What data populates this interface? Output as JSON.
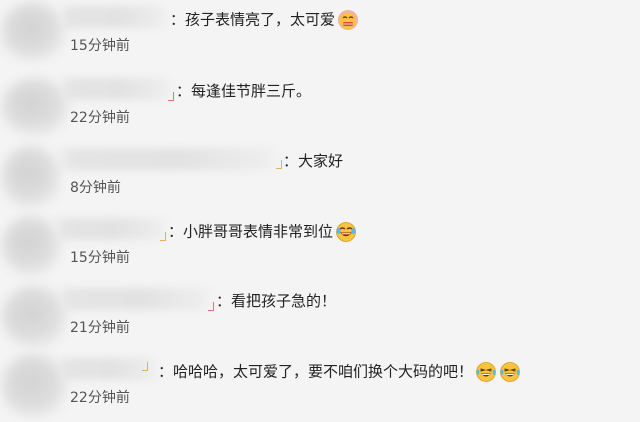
{
  "comments": [
    {
      "text": "：孩子表情亮了，太可爱",
      "time": "15分钟前",
      "emojis": [
        "blush-emoji"
      ]
    },
    {
      "text": "：每逢佳节胖三斤。",
      "time": "22分钟前",
      "emojis": []
    },
    {
      "text": "：大家好",
      "time": "8分钟前",
      "emojis": []
    },
    {
      "text": "：小胖哥哥表情非常到位",
      "time": "15分钟前",
      "emojis": [
        "laughing-tears-emoji"
      ]
    },
    {
      "text": "：看把孩子急的！",
      "time": "21分钟前",
      "emojis": []
    },
    {
      "text": "：哈哈哈，太可爱了，要不咱们换个大码的吧！",
      "time": "22分钟前",
      "emojis": [
        "grin-tears-emoji",
        "grin-tears-emoji"
      ]
    }
  ],
  "colors": {
    "background": "#f4f4f4",
    "text": "#222222",
    "timestamp": "#555555",
    "emoji_face": "#f7c440"
  }
}
